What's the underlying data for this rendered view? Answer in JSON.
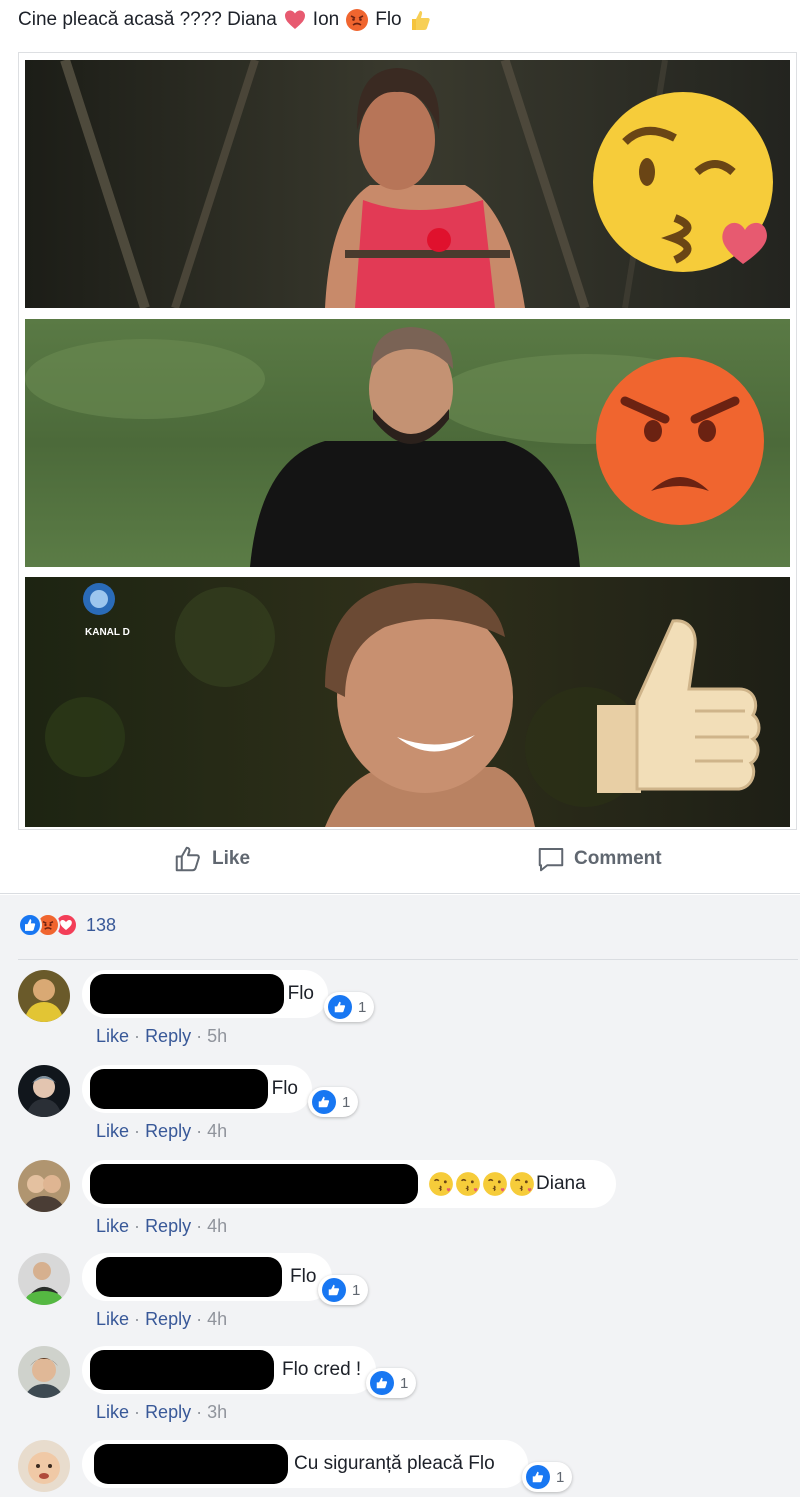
{
  "post": {
    "text_part1": "Cine pleacă acasă ???? Diana",
    "text_part2": "Ion",
    "text_part3": "Flo",
    "emojis": [
      "heart-icon",
      "angry-face-icon",
      "thumbs-up-icon"
    ],
    "image_watermark": "KANAL D"
  },
  "actions": {
    "like_label": "Like",
    "comment_label": "Comment"
  },
  "reactions": {
    "icons": [
      "like-reaction",
      "angry-reaction",
      "love-reaction"
    ],
    "count": "138"
  },
  "meta_labels": {
    "like": "Like",
    "reply": "Reply",
    "sep": "·"
  },
  "comments": [
    {
      "text": "Flo",
      "likes": "1",
      "time": "5h"
    },
    {
      "text": "Flo",
      "likes": "1",
      "time": "4h"
    },
    {
      "text": "Diana",
      "likes": "",
      "time": "4h"
    },
    {
      "text": "Flo",
      "likes": "1",
      "time": "4h"
    },
    {
      "text": "Flo cred !",
      "likes": "1",
      "time": "3h"
    },
    {
      "text": "Cu siguranță pleacă Flo",
      "likes": "1",
      "time": ""
    }
  ],
  "colors": {
    "link": "#385898",
    "like_blue": "#1877f2",
    "angry": "#f0652f",
    "love": "#f33e58",
    "bg": "#f2f3f5"
  }
}
